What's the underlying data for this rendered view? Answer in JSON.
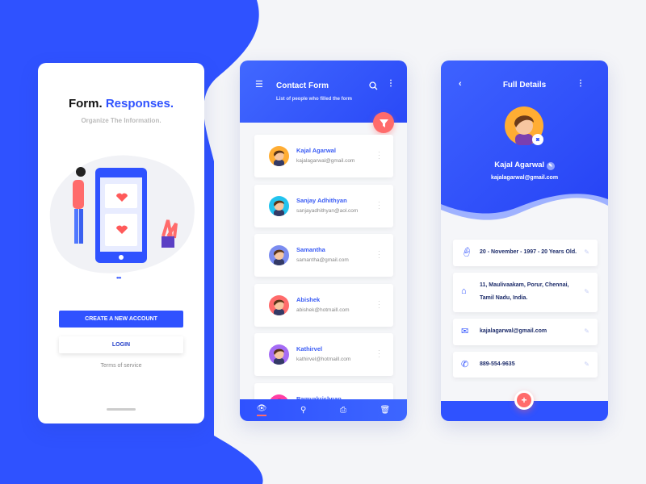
{
  "colors": {
    "primary": "#2f52ff",
    "accent": "#ff6b6b",
    "background": "#f4f5f8"
  },
  "welcome": {
    "title_black": "Form.",
    "title_blue": "Responses.",
    "subtitle": "Organize The Information.",
    "create_account": "CREATE A NEW ACCOUNT",
    "login": "LOGIN",
    "terms": "Terms of service"
  },
  "contact_form": {
    "title": "Contact Form",
    "subtitle": "List of people who filled the form",
    "icons": [
      "menu-icon",
      "search-icon",
      "more-icon",
      "filter-icon"
    ],
    "contacts": [
      {
        "name": "Kajal Agarwal",
        "email": "kajalagarwal@gmail.com",
        "color": "#ffad33"
      },
      {
        "name": "Sanjay Adhithyan",
        "email": "sanjayadhithyan@aol.com",
        "color": "#22c3ee"
      },
      {
        "name": "Samantha",
        "email": "samantha@gmail.com",
        "color": "#7b8cf0"
      },
      {
        "name": "Abishek",
        "email": "abishek@hotmaill.com",
        "color": "#ff6b6b"
      },
      {
        "name": "Kathirvel",
        "email": "kathirvel@hotmaill.com",
        "color": "#a56cf5"
      },
      {
        "name": "Ramyakrishnan",
        "email": "",
        "color": "#ff3fa4"
      }
    ],
    "nav": [
      "eye-icon",
      "hierarchy-icon",
      "print-icon",
      "trash-icon"
    ]
  },
  "details": {
    "title": "Full Details",
    "name": "Kajal Agarwal",
    "email": "kajalagarwal@gmail.com",
    "items": [
      {
        "icon": "baby-icon",
        "text": "20 - November - 1997 - 20 Years Old."
      },
      {
        "icon": "home-icon",
        "line1": "11, Maulivaakam, Porur, Chennai,",
        "line2": "Tamil Nadu, India."
      },
      {
        "icon": "mail-icon",
        "text": "kajalagarwal@gmail.com"
      },
      {
        "icon": "phone-icon",
        "text": "889-554-9635"
      }
    ],
    "fab": "+"
  }
}
